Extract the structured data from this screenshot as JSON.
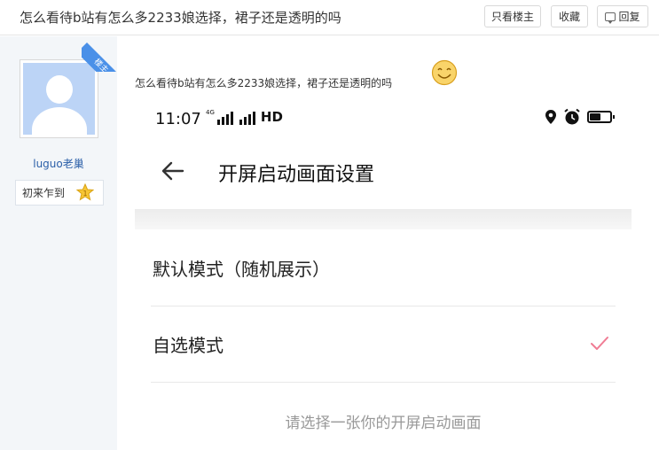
{
  "thread": {
    "title": "怎么看待b站有怎么多2233娘选择，裙子还是透明的吗"
  },
  "toolbar": {
    "only_op_label": "只看楼主",
    "favorite_label": "收藏",
    "reply_label": "回复"
  },
  "author": {
    "badge": "楼主",
    "username": "luguo老巢",
    "rank_title": "初来乍到",
    "rank_level": "1"
  },
  "post": {
    "text": "怎么看待b站有怎么多2233娘选择，裙子还是透明的吗"
  },
  "screenshot": {
    "status_time": "11:07",
    "network_label": "4G",
    "hd_label": "HD",
    "page_title": "开屏启动画面设置",
    "options": [
      {
        "label": "默认模式（随机展示）",
        "selected": false
      },
      {
        "label": "自选模式",
        "selected": true
      }
    ],
    "hint": "请选择一张你的开屏启动画面"
  },
  "colors": {
    "link": "#2b5fa8",
    "badge": "#4a90e8",
    "check": "#f07c94",
    "sidebar_bg": "#f3f6f9"
  }
}
